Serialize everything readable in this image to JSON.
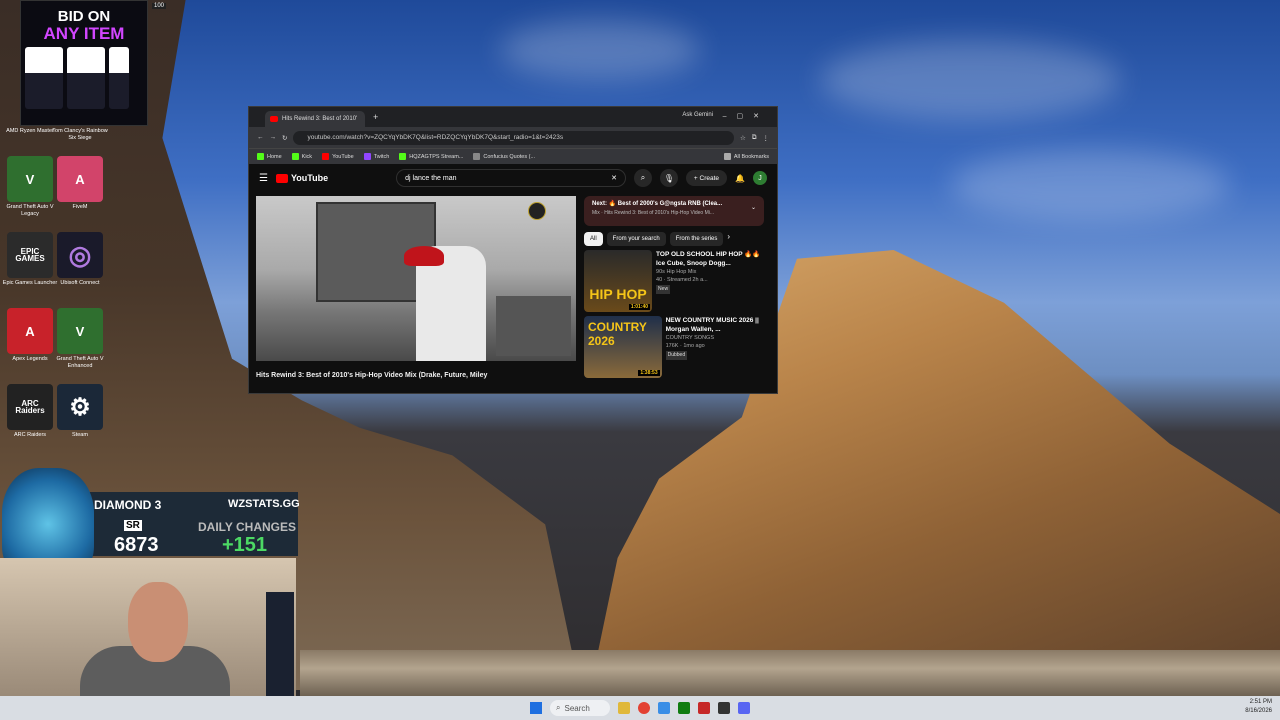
{
  "desktop": {
    "icons": [
      {
        "label": "AMD Ryzen Master",
        "tile_text": "",
        "color": "#444444"
      },
      {
        "label": "Tom Clancy's Rainbow Six Siege",
        "tile_text": "",
        "color": "#444444"
      },
      {
        "label": "Grand Theft Auto V Legacy",
        "tile_text": "V",
        "color": "#2f6f2f"
      },
      {
        "label": "FiveM",
        "tile_text": "A",
        "color": "#d2446a"
      },
      {
        "label": "Epic Games Launcher",
        "tile_text": "EPIC GAMES",
        "color": "#2b2b2b"
      },
      {
        "label": "Ubisoft Connect",
        "tile_text": "◎",
        "color": "#1a1a2a"
      },
      {
        "label": "Apex Legends",
        "tile_text": "A",
        "color": "#c8222a"
      },
      {
        "label": "Grand Theft Auto V Enhanced",
        "tile_text": "V",
        "color": "#2f6f2f"
      },
      {
        "label": "ARC Raiders",
        "tile_text": "ARC Raiders",
        "color": "#222222"
      },
      {
        "label": "Steam",
        "tile_text": "⚙",
        "color": "#1b2838"
      }
    ]
  },
  "top_badge": "100",
  "ad": {
    "line1": "BID ON",
    "line2": "ANY ITEM"
  },
  "browser": {
    "tab_title": "Hits Rewind 3: Best of 2010'",
    "ask_gemini": "Ask Gemini",
    "url": "youtube.com/watch?v=ZQCYqYbDK7Q&list=RDZQCYqYbDK7Q&start_radio=1&t=2423s",
    "bookmarks": [
      "Home",
      "Kick",
      "YouTube",
      "Twitch",
      "HQZAGTPS Stream...",
      "Confucius Quotes (..."
    ],
    "all_bookmarks": "All Bookmarks"
  },
  "youtube": {
    "brand": "YouTube",
    "search_value": "dj lance the man",
    "create_label": "Create",
    "avatar_letter": "J",
    "video_title": "Hits Rewind 3: Best of 2010's Hip-Hop Video Mix (Drake, Future, Miley",
    "next": {
      "line1": "Next: 🔥 Best of 2000's G@ngsta RNB (Clea...",
      "line2": "Mix · Hits Rewind 3: Best of 2010's Hip-Hop Video Mi..."
    },
    "chips": [
      "All",
      "From your search",
      "From the series"
    ],
    "recommendations": [
      {
        "title": "TOP OLD SCHOOL HIP HOP 🔥🔥 Ice Cube, Snoop Dogg...",
        "channel": "90s Hip Hop Mix",
        "meta": "40 · Streamed 2h a...",
        "badge": "New",
        "thumb_text": "HIP HOP",
        "duration": "1:01:40"
      },
      {
        "title": "NEW COUNTRY MUSIC 2026 || Morgan Wallen, ...",
        "channel": "COUNTRY SONGS",
        "meta": "176K · 1mo ago",
        "badge": "Dubbed",
        "thumb_text": "COUNTRY 2026",
        "duration": "1:38:53"
      }
    ]
  },
  "stream_overlay": {
    "rank": "DIAMOND 3",
    "site": "WZSTATS.GG",
    "sr_label": "SR",
    "sr_value": "6873",
    "daily_label": "DAILY CHANGES",
    "daily_value": "+151"
  },
  "taskbar": {
    "search_placeholder": "Search",
    "time": "2:51 PM",
    "date": "8/16/2026"
  }
}
